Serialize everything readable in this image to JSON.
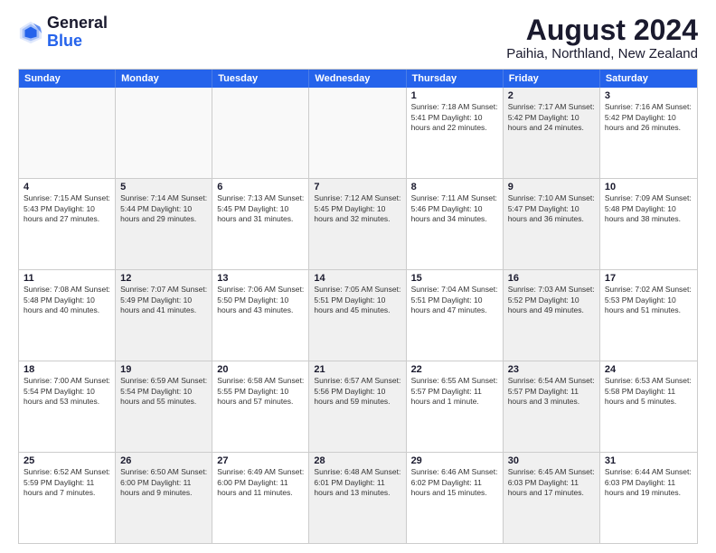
{
  "header": {
    "logo_general": "General",
    "logo_blue": "Blue",
    "title": "August 2024",
    "subtitle": "Paihia, Northland, New Zealand"
  },
  "calendar": {
    "days": [
      "Sunday",
      "Monday",
      "Tuesday",
      "Wednesday",
      "Thursday",
      "Friday",
      "Saturday"
    ],
    "rows": [
      [
        {
          "day": "",
          "content": "",
          "empty": true
        },
        {
          "day": "",
          "content": "",
          "empty": true
        },
        {
          "day": "",
          "content": "",
          "empty": true
        },
        {
          "day": "",
          "content": "",
          "empty": true
        },
        {
          "day": "1",
          "content": "Sunrise: 7:18 AM\nSunset: 5:41 PM\nDaylight: 10 hours\nand 22 minutes."
        },
        {
          "day": "2",
          "content": "Sunrise: 7:17 AM\nSunset: 5:42 PM\nDaylight: 10 hours\nand 24 minutes.",
          "shaded": true
        },
        {
          "day": "3",
          "content": "Sunrise: 7:16 AM\nSunset: 5:42 PM\nDaylight: 10 hours\nand 26 minutes."
        }
      ],
      [
        {
          "day": "4",
          "content": "Sunrise: 7:15 AM\nSunset: 5:43 PM\nDaylight: 10 hours\nand 27 minutes."
        },
        {
          "day": "5",
          "content": "Sunrise: 7:14 AM\nSunset: 5:44 PM\nDaylight: 10 hours\nand 29 minutes.",
          "shaded": true
        },
        {
          "day": "6",
          "content": "Sunrise: 7:13 AM\nSunset: 5:45 PM\nDaylight: 10 hours\nand 31 minutes."
        },
        {
          "day": "7",
          "content": "Sunrise: 7:12 AM\nSunset: 5:45 PM\nDaylight: 10 hours\nand 32 minutes.",
          "shaded": true
        },
        {
          "day": "8",
          "content": "Sunrise: 7:11 AM\nSunset: 5:46 PM\nDaylight: 10 hours\nand 34 minutes."
        },
        {
          "day": "9",
          "content": "Sunrise: 7:10 AM\nSunset: 5:47 PM\nDaylight: 10 hours\nand 36 minutes.",
          "shaded": true
        },
        {
          "day": "10",
          "content": "Sunrise: 7:09 AM\nSunset: 5:48 PM\nDaylight: 10 hours\nand 38 minutes."
        }
      ],
      [
        {
          "day": "11",
          "content": "Sunrise: 7:08 AM\nSunset: 5:48 PM\nDaylight: 10 hours\nand 40 minutes."
        },
        {
          "day": "12",
          "content": "Sunrise: 7:07 AM\nSunset: 5:49 PM\nDaylight: 10 hours\nand 41 minutes.",
          "shaded": true
        },
        {
          "day": "13",
          "content": "Sunrise: 7:06 AM\nSunset: 5:50 PM\nDaylight: 10 hours\nand 43 minutes."
        },
        {
          "day": "14",
          "content": "Sunrise: 7:05 AM\nSunset: 5:51 PM\nDaylight: 10 hours\nand 45 minutes.",
          "shaded": true
        },
        {
          "day": "15",
          "content": "Sunrise: 7:04 AM\nSunset: 5:51 PM\nDaylight: 10 hours\nand 47 minutes."
        },
        {
          "day": "16",
          "content": "Sunrise: 7:03 AM\nSunset: 5:52 PM\nDaylight: 10 hours\nand 49 minutes.",
          "shaded": true
        },
        {
          "day": "17",
          "content": "Sunrise: 7:02 AM\nSunset: 5:53 PM\nDaylight: 10 hours\nand 51 minutes."
        }
      ],
      [
        {
          "day": "18",
          "content": "Sunrise: 7:00 AM\nSunset: 5:54 PM\nDaylight: 10 hours\nand 53 minutes."
        },
        {
          "day": "19",
          "content": "Sunrise: 6:59 AM\nSunset: 5:54 PM\nDaylight: 10 hours\nand 55 minutes.",
          "shaded": true
        },
        {
          "day": "20",
          "content": "Sunrise: 6:58 AM\nSunset: 5:55 PM\nDaylight: 10 hours\nand 57 minutes."
        },
        {
          "day": "21",
          "content": "Sunrise: 6:57 AM\nSunset: 5:56 PM\nDaylight: 10 hours\nand 59 minutes.",
          "shaded": true
        },
        {
          "day": "22",
          "content": "Sunrise: 6:55 AM\nSunset: 5:57 PM\nDaylight: 11 hours\nand 1 minute."
        },
        {
          "day": "23",
          "content": "Sunrise: 6:54 AM\nSunset: 5:57 PM\nDaylight: 11 hours\nand 3 minutes.",
          "shaded": true
        },
        {
          "day": "24",
          "content": "Sunrise: 6:53 AM\nSunset: 5:58 PM\nDaylight: 11 hours\nand 5 minutes."
        }
      ],
      [
        {
          "day": "25",
          "content": "Sunrise: 6:52 AM\nSunset: 5:59 PM\nDaylight: 11 hours\nand 7 minutes."
        },
        {
          "day": "26",
          "content": "Sunrise: 6:50 AM\nSunset: 6:00 PM\nDaylight: 11 hours\nand 9 minutes.",
          "shaded": true
        },
        {
          "day": "27",
          "content": "Sunrise: 6:49 AM\nSunset: 6:00 PM\nDaylight: 11 hours\nand 11 minutes."
        },
        {
          "day": "28",
          "content": "Sunrise: 6:48 AM\nSunset: 6:01 PM\nDaylight: 11 hours\nand 13 minutes.",
          "shaded": true
        },
        {
          "day": "29",
          "content": "Sunrise: 6:46 AM\nSunset: 6:02 PM\nDaylight: 11 hours\nand 15 minutes."
        },
        {
          "day": "30",
          "content": "Sunrise: 6:45 AM\nSunset: 6:03 PM\nDaylight: 11 hours\nand 17 minutes.",
          "shaded": true
        },
        {
          "day": "31",
          "content": "Sunrise: 6:44 AM\nSunset: 6:03 PM\nDaylight: 11 hours\nand 19 minutes."
        }
      ]
    ]
  }
}
